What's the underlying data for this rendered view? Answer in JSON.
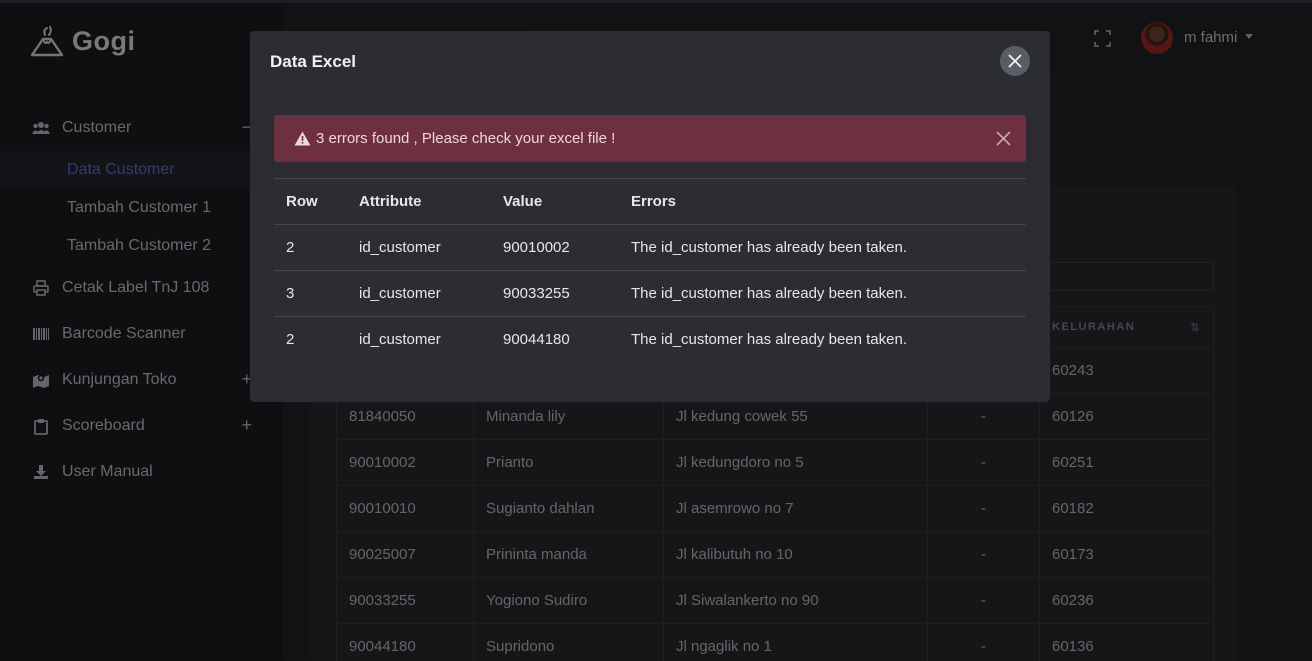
{
  "app": {
    "brand": "Gogi",
    "username": "m fahmi"
  },
  "sidebar": {
    "items": [
      {
        "label": "Customer",
        "icon": "users-icon",
        "toggle": "−"
      },
      {
        "label": "Cetak Label TnJ 108",
        "icon": "printer-icon"
      },
      {
        "label": "Barcode Scanner",
        "icon": "barcode-icon"
      },
      {
        "label": "Kunjungan Toko",
        "icon": "map-icon",
        "toggle": "+"
      },
      {
        "label": "Scoreboard",
        "icon": "clipboard-icon",
        "toggle": "+"
      },
      {
        "label": "User Manual",
        "icon": "download-icon"
      }
    ],
    "submenu": [
      {
        "label": "Data Customer",
        "active": true
      },
      {
        "label": "Tambah Customer 1"
      },
      {
        "label": "Tambah Customer 2"
      }
    ]
  },
  "background_table": {
    "header_last": "KELURAHAN",
    "rows": [
      [
        "",
        "",
        "",
        "",
        "60243"
      ],
      [
        "81840050",
        "Minanda lily",
        "Jl kedung cowek 55",
        "-",
        "60126"
      ],
      [
        "90010002",
        "Prianto",
        "Jl kedungdoro no 5",
        "-",
        "60251"
      ],
      [
        "90010010",
        "Sugianto dahlan",
        "Jl asemrowo no 7",
        "-",
        "60182"
      ],
      [
        "90025007",
        "Prininta manda",
        "Jl kalibutuh no 10",
        "-",
        "60173"
      ],
      [
        "90033255",
        "Yogiono Sudiro",
        "Jl Siwalankerto no 90",
        "-",
        "60236"
      ],
      [
        "90044180",
        "Supridono",
        "Jl ngaglik no 1",
        "-",
        "60136"
      ]
    ]
  },
  "modal": {
    "title": "Data Excel",
    "alert_text": "3 errors found , Please check your excel file !",
    "columns": [
      "Row",
      "Attribute",
      "Value",
      "Errors"
    ],
    "rows": [
      {
        "row": "2",
        "attribute": "id_customer",
        "value": "90010002",
        "error": "The id_customer has already been taken."
      },
      {
        "row": "3",
        "attribute": "id_customer",
        "value": "90033255",
        "error": "The id_customer has already been taken."
      },
      {
        "row": "2",
        "attribute": "id_customer",
        "value": "90044180",
        "error": "The id_customer has already been taken."
      }
    ]
  },
  "colors": {
    "accent": "#6e74e0",
    "alert_bg": "#6e3040",
    "modal_bg": "#2c2d32"
  }
}
